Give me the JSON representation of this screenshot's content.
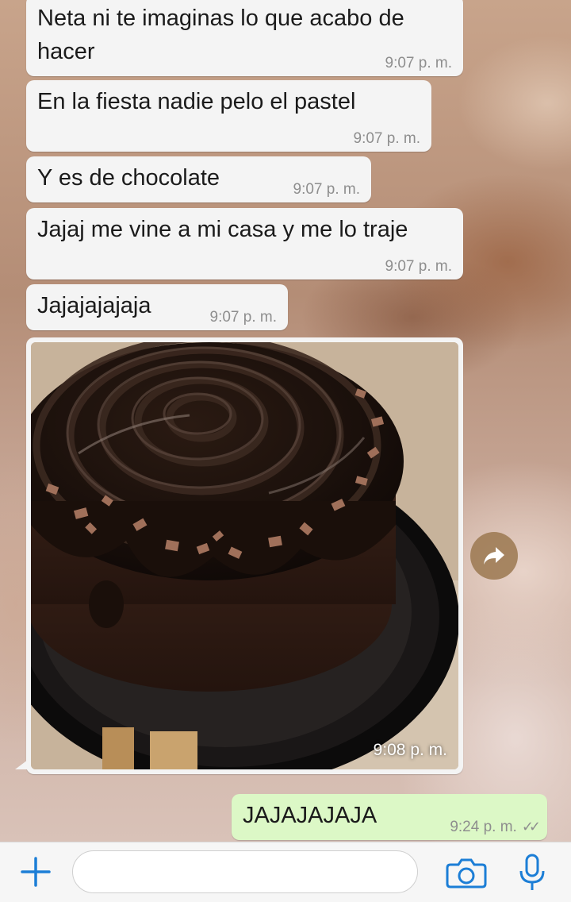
{
  "chat": {
    "messages": [
      {
        "text_line1": "Neta ni te imaginas lo que acabo de",
        "text_line2": "hacer",
        "time": "9:07 p. m."
      },
      {
        "text": "En la fiesta nadie pelo el pastel",
        "time": "9:07 p. m."
      },
      {
        "text": "Y es de chocolate",
        "time": "9:07 p. m."
      },
      {
        "text": "Jajaj me vine a mi casa y me lo traje",
        "time": "9:07 p. m."
      },
      {
        "text": "Jajajajajaja",
        "time": "9:07 p. m."
      }
    ],
    "image_message": {
      "time": "9:08 p. m.",
      "photo_icon": "chocolate-cake-photo",
      "share_icon": "share-arrow-icon"
    },
    "outgoing": {
      "text": "JAJAJAJAJA",
      "time": "9:24 p. m.",
      "status_icon": "double-check-icon",
      "ticks": "✓✓"
    }
  },
  "composer": {
    "placeholder": "",
    "icons": {
      "attach": "plus-icon",
      "camera": "camera-icon",
      "mic": "microphone-icon"
    }
  },
  "colors": {
    "incoming_bubble": "#f4f4f4",
    "outgoing_bubble": "#dcf8c6",
    "accent": "#1c7ed6"
  }
}
